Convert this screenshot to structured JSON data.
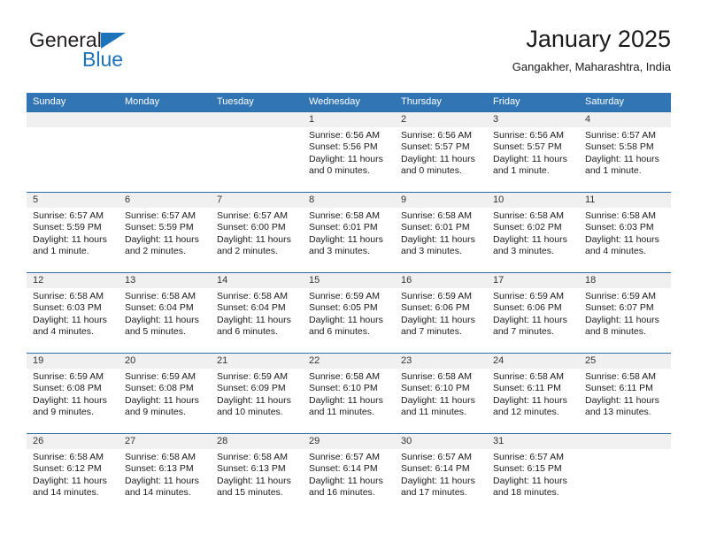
{
  "brand": {
    "name_part1": "General",
    "name_part2": "Blue",
    "accent_color": "#1c72bb"
  },
  "header": {
    "title": "January 2025",
    "subtitle": "Gangakher, Maharashtra, India"
  },
  "theme": {
    "header_row_bg": "#3175b4",
    "row_border": "#2a6ca8",
    "daynum_band_bg": "#f0f0f0"
  },
  "weekdays": [
    "Sunday",
    "Monday",
    "Tuesday",
    "Wednesday",
    "Thursday",
    "Friday",
    "Saturday"
  ],
  "labels": {
    "sunrise_prefix": "Sunrise:",
    "sunset_prefix": "Sunset:",
    "daylight_prefix": "Daylight:"
  },
  "weeks": [
    [
      {
        "day": "",
        "empty": true
      },
      {
        "day": "",
        "empty": true
      },
      {
        "day": "",
        "empty": true
      },
      {
        "day": "1",
        "sunrise": "Sunrise: 6:56 AM",
        "sunset": "Sunset: 5:56 PM",
        "daylight_line1": "Daylight: 11 hours",
        "daylight_line2": "and 0 minutes."
      },
      {
        "day": "2",
        "sunrise": "Sunrise: 6:56 AM",
        "sunset": "Sunset: 5:57 PM",
        "daylight_line1": "Daylight: 11 hours",
        "daylight_line2": "and 0 minutes."
      },
      {
        "day": "3",
        "sunrise": "Sunrise: 6:56 AM",
        "sunset": "Sunset: 5:57 PM",
        "daylight_line1": "Daylight: 11 hours",
        "daylight_line2": "and 1 minute."
      },
      {
        "day": "4",
        "sunrise": "Sunrise: 6:57 AM",
        "sunset": "Sunset: 5:58 PM",
        "daylight_line1": "Daylight: 11 hours",
        "daylight_line2": "and 1 minute."
      }
    ],
    [
      {
        "day": "5",
        "sunrise": "Sunrise: 6:57 AM",
        "sunset": "Sunset: 5:59 PM",
        "daylight_line1": "Daylight: 11 hours",
        "daylight_line2": "and 1 minute."
      },
      {
        "day": "6",
        "sunrise": "Sunrise: 6:57 AM",
        "sunset": "Sunset: 5:59 PM",
        "daylight_line1": "Daylight: 11 hours",
        "daylight_line2": "and 2 minutes."
      },
      {
        "day": "7",
        "sunrise": "Sunrise: 6:57 AM",
        "sunset": "Sunset: 6:00 PM",
        "daylight_line1": "Daylight: 11 hours",
        "daylight_line2": "and 2 minutes."
      },
      {
        "day": "8",
        "sunrise": "Sunrise: 6:58 AM",
        "sunset": "Sunset: 6:01 PM",
        "daylight_line1": "Daylight: 11 hours",
        "daylight_line2": "and 3 minutes."
      },
      {
        "day": "9",
        "sunrise": "Sunrise: 6:58 AM",
        "sunset": "Sunset: 6:01 PM",
        "daylight_line1": "Daylight: 11 hours",
        "daylight_line2": "and 3 minutes."
      },
      {
        "day": "10",
        "sunrise": "Sunrise: 6:58 AM",
        "sunset": "Sunset: 6:02 PM",
        "daylight_line1": "Daylight: 11 hours",
        "daylight_line2": "and 3 minutes."
      },
      {
        "day": "11",
        "sunrise": "Sunrise: 6:58 AM",
        "sunset": "Sunset: 6:03 PM",
        "daylight_line1": "Daylight: 11 hours",
        "daylight_line2": "and 4 minutes."
      }
    ],
    [
      {
        "day": "12",
        "sunrise": "Sunrise: 6:58 AM",
        "sunset": "Sunset: 6:03 PM",
        "daylight_line1": "Daylight: 11 hours",
        "daylight_line2": "and 4 minutes."
      },
      {
        "day": "13",
        "sunrise": "Sunrise: 6:58 AM",
        "sunset": "Sunset: 6:04 PM",
        "daylight_line1": "Daylight: 11 hours",
        "daylight_line2": "and 5 minutes."
      },
      {
        "day": "14",
        "sunrise": "Sunrise: 6:58 AM",
        "sunset": "Sunset: 6:04 PM",
        "daylight_line1": "Daylight: 11 hours",
        "daylight_line2": "and 6 minutes."
      },
      {
        "day": "15",
        "sunrise": "Sunrise: 6:59 AM",
        "sunset": "Sunset: 6:05 PM",
        "daylight_line1": "Daylight: 11 hours",
        "daylight_line2": "and 6 minutes."
      },
      {
        "day": "16",
        "sunrise": "Sunrise: 6:59 AM",
        "sunset": "Sunset: 6:06 PM",
        "daylight_line1": "Daylight: 11 hours",
        "daylight_line2": "and 7 minutes."
      },
      {
        "day": "17",
        "sunrise": "Sunrise: 6:59 AM",
        "sunset": "Sunset: 6:06 PM",
        "daylight_line1": "Daylight: 11 hours",
        "daylight_line2": "and 7 minutes."
      },
      {
        "day": "18",
        "sunrise": "Sunrise: 6:59 AM",
        "sunset": "Sunset: 6:07 PM",
        "daylight_line1": "Daylight: 11 hours",
        "daylight_line2": "and 8 minutes."
      }
    ],
    [
      {
        "day": "19",
        "sunrise": "Sunrise: 6:59 AM",
        "sunset": "Sunset: 6:08 PM",
        "daylight_line1": "Daylight: 11 hours",
        "daylight_line2": "and 9 minutes."
      },
      {
        "day": "20",
        "sunrise": "Sunrise: 6:59 AM",
        "sunset": "Sunset: 6:08 PM",
        "daylight_line1": "Daylight: 11 hours",
        "daylight_line2": "and 9 minutes."
      },
      {
        "day": "21",
        "sunrise": "Sunrise: 6:59 AM",
        "sunset": "Sunset: 6:09 PM",
        "daylight_line1": "Daylight: 11 hours",
        "daylight_line2": "and 10 minutes."
      },
      {
        "day": "22",
        "sunrise": "Sunrise: 6:58 AM",
        "sunset": "Sunset: 6:10 PM",
        "daylight_line1": "Daylight: 11 hours",
        "daylight_line2": "and 11 minutes."
      },
      {
        "day": "23",
        "sunrise": "Sunrise: 6:58 AM",
        "sunset": "Sunset: 6:10 PM",
        "daylight_line1": "Daylight: 11 hours",
        "daylight_line2": "and 11 minutes."
      },
      {
        "day": "24",
        "sunrise": "Sunrise: 6:58 AM",
        "sunset": "Sunset: 6:11 PM",
        "daylight_line1": "Daylight: 11 hours",
        "daylight_line2": "and 12 minutes."
      },
      {
        "day": "25",
        "sunrise": "Sunrise: 6:58 AM",
        "sunset": "Sunset: 6:11 PM",
        "daylight_line1": "Daylight: 11 hours",
        "daylight_line2": "and 13 minutes."
      }
    ],
    [
      {
        "day": "26",
        "sunrise": "Sunrise: 6:58 AM",
        "sunset": "Sunset: 6:12 PM",
        "daylight_line1": "Daylight: 11 hours",
        "daylight_line2": "and 14 minutes."
      },
      {
        "day": "27",
        "sunrise": "Sunrise: 6:58 AM",
        "sunset": "Sunset: 6:13 PM",
        "daylight_line1": "Daylight: 11 hours",
        "daylight_line2": "and 14 minutes."
      },
      {
        "day": "28",
        "sunrise": "Sunrise: 6:58 AM",
        "sunset": "Sunset: 6:13 PM",
        "daylight_line1": "Daylight: 11 hours",
        "daylight_line2": "and 15 minutes."
      },
      {
        "day": "29",
        "sunrise": "Sunrise: 6:57 AM",
        "sunset": "Sunset: 6:14 PM",
        "daylight_line1": "Daylight: 11 hours",
        "daylight_line2": "and 16 minutes."
      },
      {
        "day": "30",
        "sunrise": "Sunrise: 6:57 AM",
        "sunset": "Sunset: 6:14 PM",
        "daylight_line1": "Daylight: 11 hours",
        "daylight_line2": "and 17 minutes."
      },
      {
        "day": "31",
        "sunrise": "Sunrise: 6:57 AM",
        "sunset": "Sunset: 6:15 PM",
        "daylight_line1": "Daylight: 11 hours",
        "daylight_line2": "and 18 minutes."
      },
      {
        "day": "",
        "empty": true
      }
    ]
  ]
}
